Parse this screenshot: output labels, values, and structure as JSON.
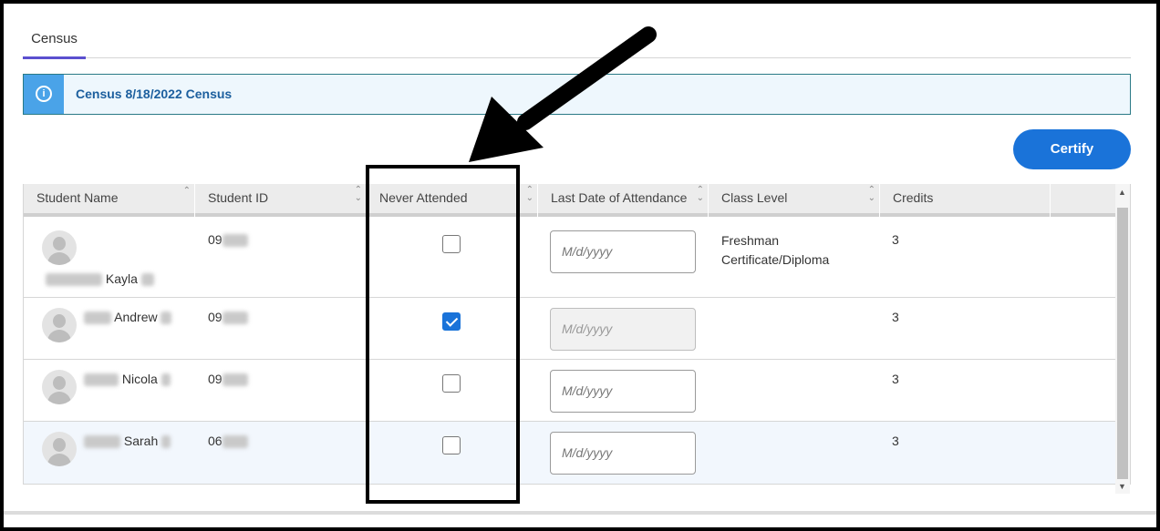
{
  "tabs": [
    {
      "label": "Census",
      "active": true
    }
  ],
  "banner": {
    "icon": "info-icon",
    "text": "Census 8/18/2022 Census"
  },
  "certify_label": "Certify",
  "columns": [
    "Student Name",
    "Student ID",
    "Never Attended",
    "Last Date of Attendance",
    "Class Level",
    "Credits"
  ],
  "rows": [
    {
      "first_name": "Kayla",
      "id_prefix": "09",
      "never_attended": false,
      "date_placeholder": "M/d/yyyy",
      "date_disabled": false,
      "class_level": "Freshman Certificate/Diploma",
      "credits": "3"
    },
    {
      "first_name": "Andrew",
      "id_prefix": "09",
      "never_attended": true,
      "date_placeholder": "M/d/yyyy",
      "date_disabled": true,
      "class_level": "",
      "credits": "3"
    },
    {
      "first_name": "Nicola",
      "id_prefix": "09",
      "never_attended": false,
      "date_placeholder": "M/d/yyyy",
      "date_disabled": false,
      "class_level": "",
      "credits": "3"
    },
    {
      "first_name": "Sarah",
      "id_prefix": "06",
      "never_attended": false,
      "date_placeholder": "M/d/yyyy",
      "date_disabled": false,
      "class_level": "",
      "credits": "3"
    }
  ],
  "colors": {
    "accent": "#1a73d9",
    "tab_underline": "#5b4fcf",
    "banner_bg": "#eef7fd",
    "banner_icon_bg": "#4aa3e8"
  }
}
